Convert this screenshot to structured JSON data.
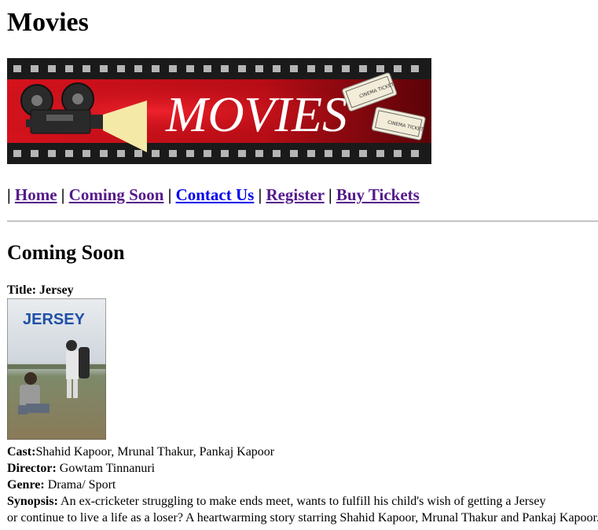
{
  "site": {
    "title": "Movies",
    "banner_text": "MOVIES",
    "ticket_text": "CINEMA TICKET"
  },
  "nav": {
    "sep": "|",
    "items": [
      {
        "label": "Home",
        "state": "visited"
      },
      {
        "label": "Coming Soon",
        "state": "visited"
      },
      {
        "label": "Contact Us",
        "state": "unvisited"
      },
      {
        "label": "Register",
        "state": "visited"
      },
      {
        "label": "Buy Tickets",
        "state": "visited"
      }
    ]
  },
  "section": {
    "heading": "Coming Soon"
  },
  "movie": {
    "title_label": "Title: Jersey",
    "poster_text": "JERSEY",
    "cast_label": "Cast:",
    "cast_value": "Shahid Kapoor, Mrunal Thakur, Pankaj Kapoor",
    "director_label": "Director:",
    "director_value": " Gowtam Tinnanuri",
    "genre_label": "Genre:",
    "genre_value": " Drama/ Sport",
    "synopsis_label": "Synopsis:",
    "synopsis_line1": " An ex-cricketer struggling to make ends meet, wants to fulfill his child's wish of getting a Jersey",
    "synopsis_line2": "or continue to live a life as a loser? A heartwarming story starring Shahid Kapoor, Mrunal Thakur and Pankaj Kapoor."
  },
  "colors": {
    "link_visited": "#551a8b",
    "link_unvisited": "#0000ee",
    "banner_red": "#c8101a",
    "banner_dark": "#1a1a1a"
  }
}
